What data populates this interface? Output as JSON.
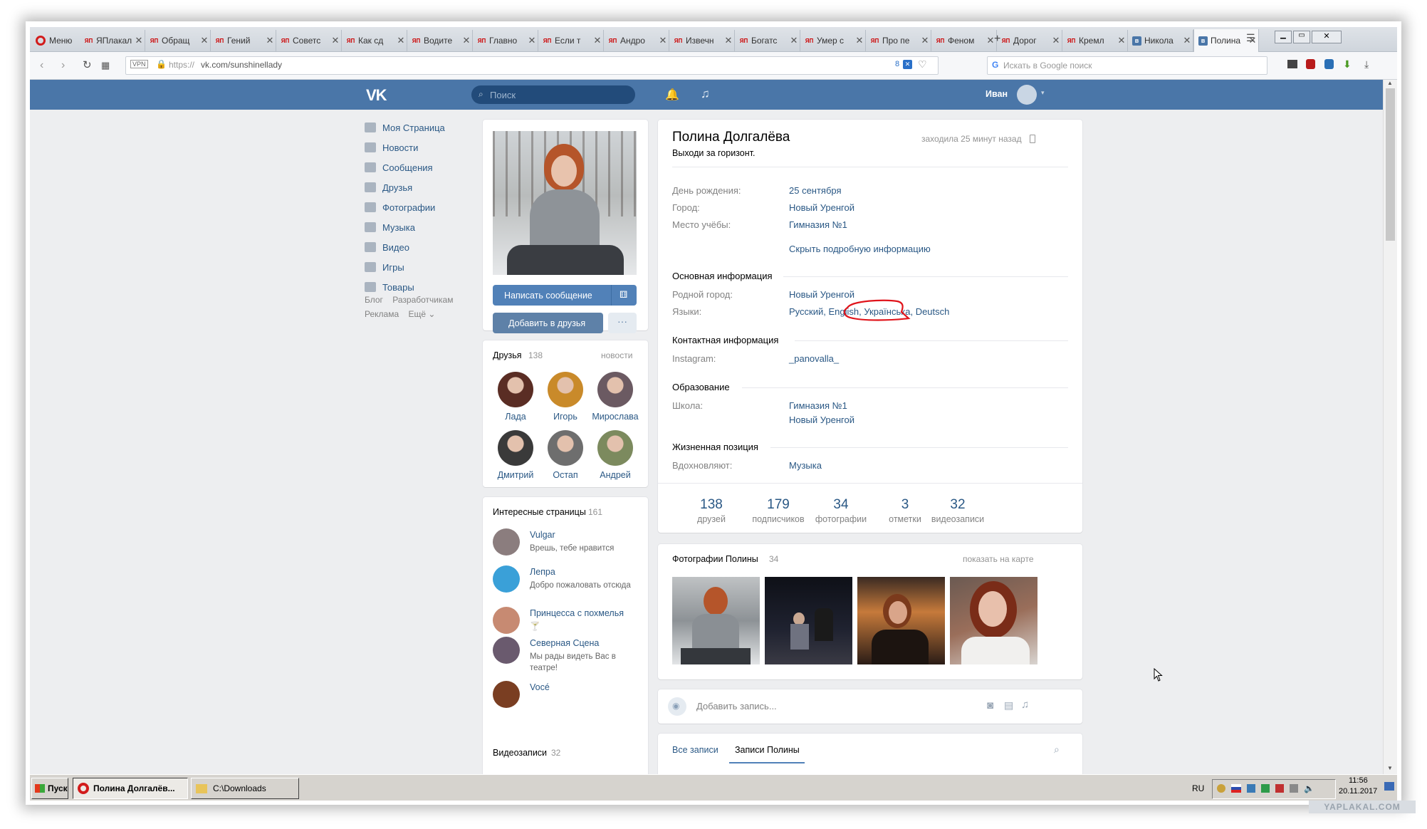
{
  "browser": {
    "menu_label": "Меню",
    "tabs": [
      {
        "title": "ЯПлакал",
        "icon": "yaplakal-icon"
      },
      {
        "title": "Обращ",
        "icon": "yaplakal-icon"
      },
      {
        "title": "Гений",
        "icon": "yaplakal-icon"
      },
      {
        "title": "Советс",
        "icon": "yaplakal-icon"
      },
      {
        "title": "Как сд",
        "icon": "yaplakal-icon"
      },
      {
        "title": "Водите",
        "icon": "yaplakal-icon"
      },
      {
        "title": "Главно",
        "icon": "yaplakal-icon"
      },
      {
        "title": "Если т",
        "icon": "yaplakal-icon"
      },
      {
        "title": "Андро",
        "icon": "yaplakal-icon"
      },
      {
        "title": "Извечн",
        "icon": "yaplakal-icon"
      },
      {
        "title": "Богатс",
        "icon": "yaplakal-icon"
      },
      {
        "title": "Умер с",
        "icon": "yaplakal-icon"
      },
      {
        "title": "Про пе",
        "icon": "yaplakal-icon"
      },
      {
        "title": "Феном",
        "icon": "yaplakal-icon"
      },
      {
        "title": "Дорог",
        "icon": "yaplakal-icon"
      },
      {
        "title": "Кремл",
        "icon": "yaplakal-icon"
      },
      {
        "title": "Никола",
        "icon": "vk-icon"
      },
      {
        "title": "Полина",
        "icon": "vk-icon"
      }
    ],
    "url_scheme": "https://",
    "url_host": "vk.com/sunshinellady",
    "vpn_label": "VPN",
    "badge_count": "8",
    "search_placeholder": "Искать в Google поиск"
  },
  "vk": {
    "header": {
      "logo": "VK",
      "search_placeholder": "Поиск",
      "user_name": "Иван"
    },
    "sidebar": {
      "items": [
        {
          "label": "Моя Страница",
          "icon": "home-icon"
        },
        {
          "label": "Новости",
          "icon": "news-icon"
        },
        {
          "label": "Сообщения",
          "icon": "messages-icon"
        },
        {
          "label": "Друзья",
          "icon": "friends-icon"
        },
        {
          "label": "Фотографии",
          "icon": "camera-icon"
        },
        {
          "label": "Музыка",
          "icon": "music-icon"
        },
        {
          "label": "Видео",
          "icon": "video-icon"
        },
        {
          "label": "Игры",
          "icon": "games-icon"
        },
        {
          "label": "Товары",
          "icon": "bag-icon"
        }
      ],
      "footer": [
        "Блог",
        "Разработчикам",
        "Реклама",
        "Ещё"
      ]
    },
    "left_col": {
      "write_message_btn": "Написать сообщение",
      "add_friend_btn": "Добавить в друзья",
      "friends_title": "Друзья",
      "friends_count": "138",
      "friends_updates": "новости",
      "friends": [
        {
          "name": "Лада",
          "color": "#5a2d24"
        },
        {
          "name": "Игорь",
          "color": "#c98a2a"
        },
        {
          "name": "Мирослава",
          "color": "#6b5a62"
        },
        {
          "name": "Дмитрий",
          "color": "#3a3a3a"
        },
        {
          "name": "Остап",
          "color": "#6e6e6e"
        },
        {
          "name": "Андрей",
          "color": "#7c8a5e"
        }
      ],
      "interesting_title": "Интересные страницы",
      "interesting_count": "161",
      "interesting": [
        {
          "name": "Vulgar",
          "desc": "Врешь, тебе нравится",
          "color": "#8b7d7e"
        },
        {
          "name": "Лепра",
          "desc": "Добро пожаловать отсюда",
          "color": "#3aa0d8"
        },
        {
          "name": "Принцесса с похмелья",
          "desc": "🍸",
          "color": "#c78a72"
        },
        {
          "name": "Северная Сцена",
          "desc": "Мы рады видеть Вас в театре!",
          "color": "#6a5a6e"
        },
        {
          "name": "Vocé",
          "desc": "",
          "color": "#7a3e22"
        }
      ],
      "videos_title": "Видеозаписи",
      "videos_count": "32"
    },
    "profile": {
      "name": "Полина Долгалёва",
      "status": "Выходи за горизонт.",
      "last_seen": "заходила 25 минут назад",
      "birthday_label": "День рождения:",
      "birthday": "25 сентября",
      "city_label": "Город:",
      "city": "Новый Уренгой",
      "study_label": "Место учёбы:",
      "study": "Гимназия №1",
      "hide_info": "Скрыть подробную информацию",
      "basic_title": "Основная информация",
      "hometown_label": "Родной город:",
      "hometown": "Новый Уренгой",
      "languages_label": "Языки:",
      "lang_1": "Русский",
      "lang_2": "English",
      "lang_3": "Українська",
      "lang_4": "Deutsch",
      "contact_title": "Контактная информация",
      "instagram_label": "Instagram:",
      "instagram": "_panovalla_",
      "education_title": "Образование",
      "school_label": "Школа:",
      "school": "Гимназия №1",
      "school_city": "Новый Уренгой",
      "life_title": "Жизненная позиция",
      "inspire_label": "Вдохновляют:",
      "inspire": "Музыка",
      "counters": [
        {
          "num": "138",
          "label": "друзей"
        },
        {
          "num": "179",
          "label": "подписчиков"
        },
        {
          "num": "34",
          "label": "фотографии"
        },
        {
          "num": "3",
          "label": "отметки"
        },
        {
          "num": "32",
          "label": "видеозаписи"
        }
      ],
      "photos_title": "Фотографии Полины",
      "photos_count": "34",
      "photos_map": "показать на карте",
      "add_post_placeholder": "Добавить запись...",
      "wall_all": "Все записи",
      "wall_own": "Записи Полины"
    }
  },
  "taskbar": {
    "start": "Пуск",
    "task1": "Полина Долгалёв...",
    "task2": "C:\\Downloads",
    "lang": "RU",
    "time": "11:56",
    "date": "20.11.2017"
  },
  "watermark": "YAPLAKAL.COM",
  "colors": {
    "vk_blue": "#4a76a8",
    "link": "#2a5885",
    "button": "#5181b8",
    "annotation": "#e0141b"
  }
}
